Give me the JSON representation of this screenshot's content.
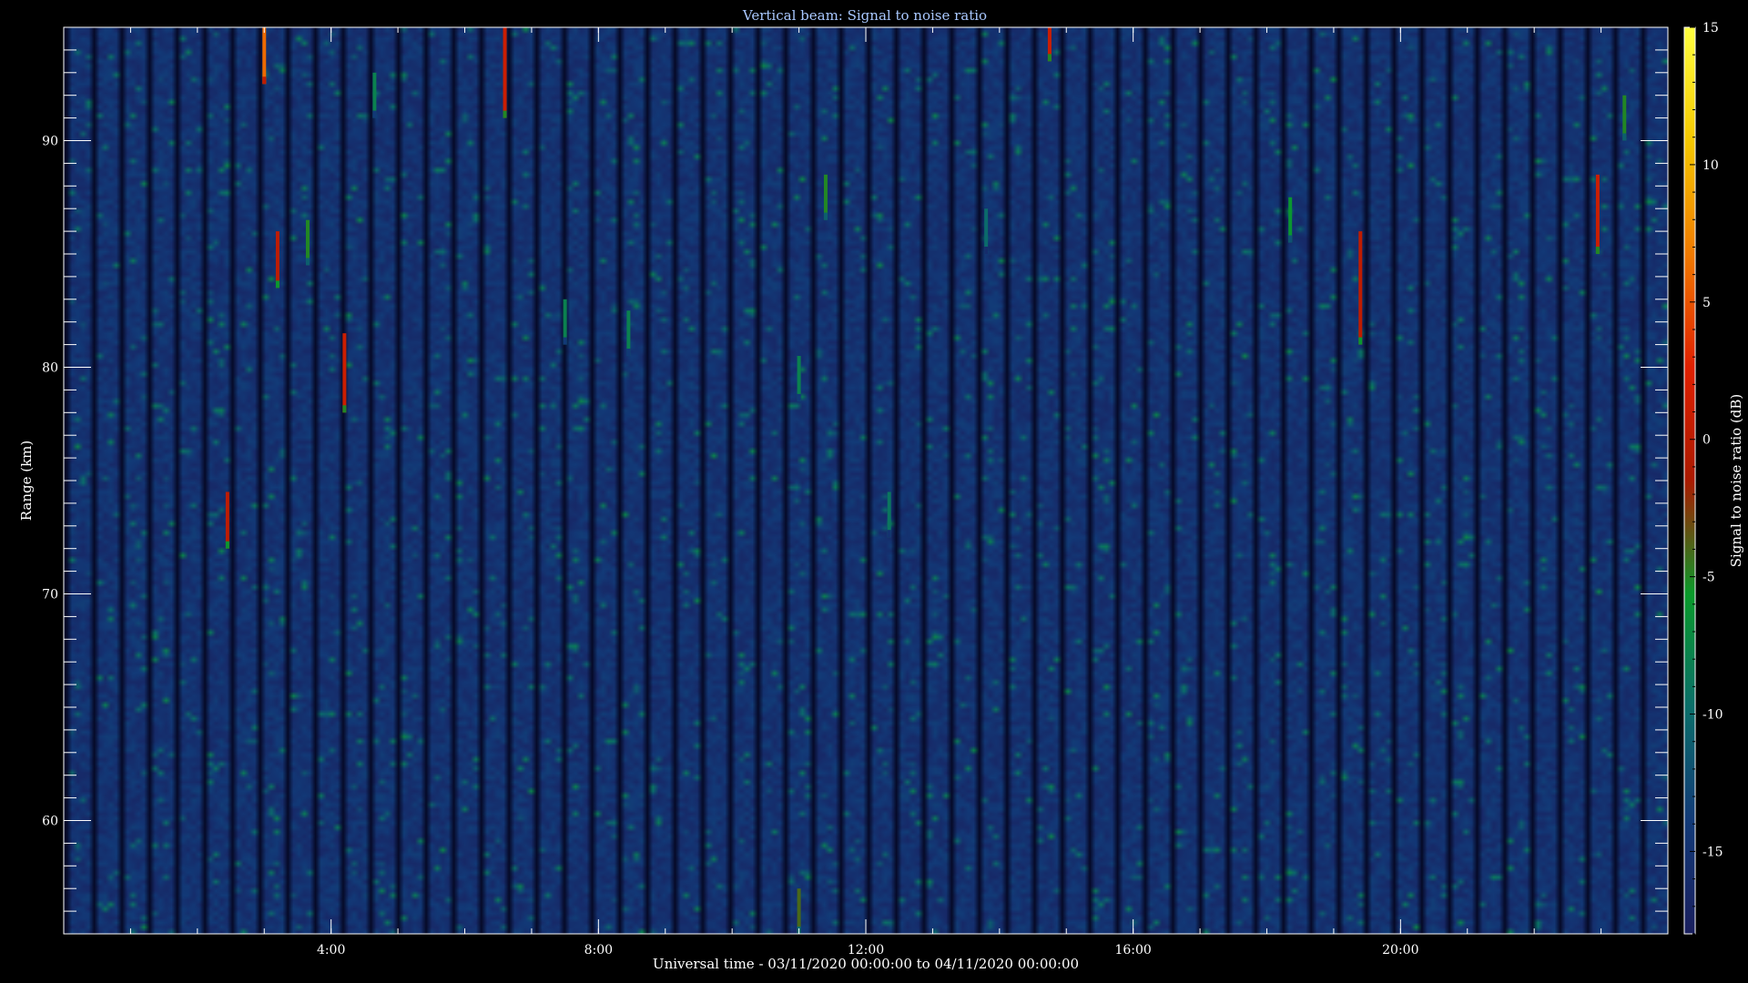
{
  "chart_data": {
    "type": "heatmap",
    "title": "Vertical beam: Signal to noise ratio",
    "xlabel": "Universal time - 03/11/2020 00:00:00 to 04/11/2020 00:00:00",
    "ylabel": "Range (km)",
    "colorbar_label": "Signal to noise ratio (dB)",
    "xlim_hours": [
      0,
      24
    ],
    "ylim_km": [
      55,
      95
    ],
    "clim_db": [
      -18,
      15
    ],
    "x_ticks": [
      {
        "hour": 4,
        "label": "4:00"
      },
      {
        "hour": 8,
        "label": "8:00"
      },
      {
        "hour": 12,
        "label": "12:00"
      },
      {
        "hour": 16,
        "label": "16:00"
      },
      {
        "hour": 20,
        "label": "20:00"
      }
    ],
    "y_ticks": [
      {
        "km": 60,
        "label": "60"
      },
      {
        "km": 70,
        "label": "70"
      },
      {
        "km": 80,
        "label": "80"
      },
      {
        "km": 90,
        "label": "90"
      }
    ],
    "colorbar_ticks": [
      {
        "db": 15,
        "label": "15"
      },
      {
        "db": 10,
        "label": "10"
      },
      {
        "db": 5,
        "label": "5"
      },
      {
        "db": 0,
        "label": "0"
      },
      {
        "db": -5,
        "label": "-5"
      },
      {
        "db": -10,
        "label": "-10"
      },
      {
        "db": -15,
        "label": "-15"
      }
    ],
    "colormap": [
      "#1a1f5e",
      "#123a78",
      "#0b6e6a",
      "#0a9a2a",
      "#aa1a00",
      "#e02000",
      "#f07a00",
      "#f5c800",
      "#ffff40"
    ],
    "background_db": -15,
    "echoes": [
      {
        "hour": 2.45,
        "km_min": 72,
        "km_max": 74.5,
        "db": 0
      },
      {
        "hour": 3.0,
        "km_min": 92.5,
        "km_max": 95,
        "db": 6
      },
      {
        "hour": 3.2,
        "km_min": 83.5,
        "km_max": 86,
        "db": 0
      },
      {
        "hour": 3.65,
        "km_min": 84.5,
        "km_max": 86.5,
        "db": -5
      },
      {
        "hour": 4.2,
        "km_min": 78,
        "km_max": 81.5,
        "db": 1
      },
      {
        "hour": 4.65,
        "km_min": 91,
        "km_max": 93,
        "db": -8
      },
      {
        "hour": 6.6,
        "km_min": 91,
        "km_max": 95,
        "db": 1
      },
      {
        "hour": 7.5,
        "km_min": 81,
        "km_max": 83,
        "db": -8
      },
      {
        "hour": 8.45,
        "km_min": 80.5,
        "km_max": 82.5,
        "db": -8
      },
      {
        "hour": 11.0,
        "km_min": 55,
        "km_max": 57,
        "db": -4
      },
      {
        "hour": 11.0,
        "km_min": 78.5,
        "km_max": 80.5,
        "db": -8
      },
      {
        "hour": 11.4,
        "km_min": 86.5,
        "km_max": 88.5,
        "db": -5
      },
      {
        "hour": 12.35,
        "km_min": 72.5,
        "km_max": 74.5,
        "db": -9
      },
      {
        "hour": 13.8,
        "km_min": 85,
        "km_max": 87,
        "db": -10
      },
      {
        "hour": 14.75,
        "km_min": 93.5,
        "km_max": 95,
        "db": 1
      },
      {
        "hour": 18.35,
        "km_min": 85.5,
        "km_max": 87.5,
        "db": -6
      },
      {
        "hour": 19.4,
        "km_min": 81,
        "km_max": 86,
        "db": 0
      },
      {
        "hour": 22.95,
        "km_min": 85,
        "km_max": 88.5,
        "db": 1
      },
      {
        "hour": 23.35,
        "km_min": 90,
        "km_max": 92,
        "db": -5
      }
    ]
  }
}
